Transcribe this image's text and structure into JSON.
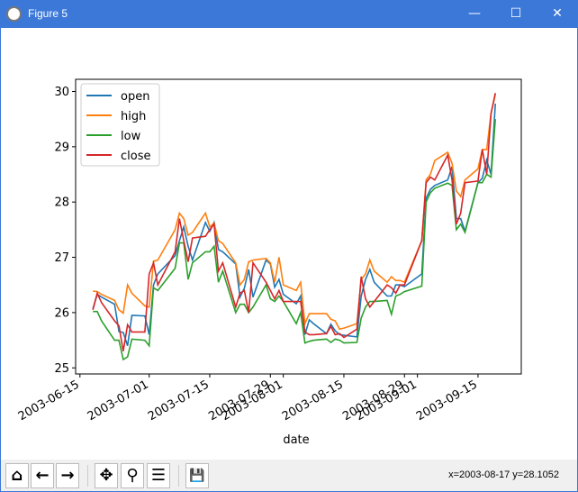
{
  "window": {
    "title": "Figure 5",
    "minimize": "—",
    "maximize": "☐",
    "close": "✕"
  },
  "toolbar": {
    "home": "⌂",
    "back": "←",
    "forward": "→",
    "pan": "✥",
    "zoom": "⚲",
    "configure": "☰",
    "save": "💾",
    "coords": "x=2003-08-17 y=28.1052"
  },
  "chart_data": {
    "type": "line",
    "title": "",
    "xlabel": "date",
    "ylabel": "",
    "xlim": [
      "2003-06-14",
      "2003-09-25"
    ],
    "ylim": [
      24.89,
      30.22
    ],
    "yticks": [
      25,
      26,
      27,
      28,
      29,
      30
    ],
    "xticks": [
      "2003-06-15",
      "2003-07-01",
      "2003-07-15",
      "2003-07-29",
      "2003-08-01",
      "2003-08-15",
      "2003-08-29",
      "2003-09-01",
      "2003-09-15"
    ],
    "legend": {
      "placement": "upper-left",
      "entries": [
        "open",
        "high",
        "low",
        "close"
      ]
    },
    "colors": {
      "open": "#1f77b4",
      "high": "#ff7f0e",
      "low": "#2ca02c",
      "close": "#d62728"
    },
    "x": [
      "2003-06-18",
      "2003-06-19",
      "2003-06-20",
      "2003-06-23",
      "2003-06-24",
      "2003-06-25",
      "2003-06-26",
      "2003-06-27",
      "2003-06-30",
      "2003-07-01",
      "2003-07-02",
      "2003-07-03",
      "2003-07-07",
      "2003-07-08",
      "2003-07-09",
      "2003-07-10",
      "2003-07-11",
      "2003-07-14",
      "2003-07-15",
      "2003-07-16",
      "2003-07-17",
      "2003-07-18",
      "2003-07-21",
      "2003-07-22",
      "2003-07-23",
      "2003-07-24",
      "2003-07-25",
      "2003-07-28",
      "2003-07-29",
      "2003-07-30",
      "2003-07-31",
      "2003-08-01",
      "2003-08-04",
      "2003-08-05",
      "2003-08-06",
      "2003-08-07",
      "2003-08-08",
      "2003-08-11",
      "2003-08-12",
      "2003-08-13",
      "2003-08-14",
      "2003-08-15",
      "2003-08-18",
      "2003-08-19",
      "2003-08-20",
      "2003-08-21",
      "2003-08-22",
      "2003-08-25",
      "2003-08-26",
      "2003-08-27",
      "2003-08-28",
      "2003-08-29",
      "2003-09-02",
      "2003-09-03",
      "2003-09-04",
      "2003-09-05",
      "2003-09-08",
      "2003-09-09",
      "2003-09-10",
      "2003-09-11",
      "2003-09-12",
      "2003-09-15",
      "2003-09-16",
      "2003-09-17",
      "2003-09-18",
      "2003-09-19"
    ],
    "series": [
      {
        "name": "open",
        "values": [
          26.07,
          26.33,
          26.28,
          26.15,
          25.66,
          25.64,
          25.4,
          25.95,
          25.94,
          25.6,
          26.5,
          26.7,
          27.03,
          27.3,
          27.55,
          27.2,
          26.95,
          27.63,
          27.47,
          27.63,
          27.14,
          27.1,
          26.88,
          26.28,
          26.44,
          26.78,
          26.28,
          26.95,
          26.88,
          26.46,
          26.6,
          26.33,
          26.16,
          26.3,
          25.6,
          25.87,
          25.8,
          25.62,
          25.79,
          25.67,
          25.6,
          25.59,
          25.56,
          26.3,
          26.6,
          26.78,
          26.55,
          26.3,
          26.3,
          26.5,
          26.5,
          26.47,
          26.7,
          28.07,
          28.23,
          28.3,
          28.4,
          28.64,
          27.7,
          27.7,
          27.47,
          28.35,
          28.43,
          28.76,
          28.5,
          29.78
        ]
      },
      {
        "name": "high",
        "values": [
          26.39,
          26.38,
          26.33,
          26.22,
          26.05,
          25.99,
          26.5,
          26.35,
          26.12,
          26.1,
          26.93,
          26.95,
          27.5,
          27.8,
          27.7,
          27.4,
          27.45,
          27.8,
          27.55,
          27.62,
          27.3,
          27.25,
          26.9,
          26.5,
          26.6,
          26.92,
          26.95,
          26.98,
          26.9,
          26.55,
          27.0,
          26.5,
          26.4,
          26.55,
          25.8,
          25.98,
          25.98,
          25.98,
          25.88,
          25.85,
          25.7,
          25.72,
          25.8,
          26.6,
          26.7,
          26.95,
          26.75,
          26.55,
          26.65,
          26.58,
          26.58,
          26.55,
          27.3,
          28.4,
          28.5,
          28.75,
          28.9,
          28.7,
          28.2,
          28.1,
          28.4,
          28.6,
          28.95,
          28.95,
          29.6,
          29.95
        ]
      },
      {
        "name": "low",
        "values": [
          26.02,
          26.02,
          25.85,
          25.5,
          25.5,
          25.15,
          25.2,
          25.52,
          25.5,
          25.4,
          26.45,
          26.4,
          26.8,
          27.26,
          27.26,
          26.6,
          26.9,
          27.1,
          27.1,
          27.2,
          26.55,
          26.75,
          26.0,
          26.15,
          26.15,
          26.0,
          26.1,
          26.5,
          26.25,
          26.2,
          26.3,
          26.2,
          25.8,
          26.0,
          25.45,
          25.48,
          25.5,
          25.52,
          25.46,
          25.52,
          25.5,
          25.45,
          25.46,
          25.9,
          26.1,
          26.2,
          26.2,
          26.22,
          25.97,
          26.3,
          26.33,
          26.38,
          26.48,
          28.0,
          28.17,
          28.25,
          28.34,
          28.3,
          27.5,
          27.6,
          27.45,
          28.35,
          28.35,
          28.5,
          28.45,
          29.5
        ]
      },
      {
        "name": "close",
        "values": [
          26.05,
          26.35,
          26.18,
          25.85,
          25.76,
          25.3,
          25.78,
          25.65,
          25.65,
          26.7,
          26.9,
          26.5,
          27.1,
          27.7,
          27.3,
          26.92,
          27.35,
          27.38,
          27.5,
          27.6,
          26.75,
          26.9,
          26.1,
          26.35,
          26.4,
          26.0,
          26.9,
          26.55,
          26.4,
          26.25,
          26.4,
          26.2,
          26.2,
          26.2,
          25.65,
          25.6,
          25.6,
          25.62,
          25.75,
          25.6,
          25.62,
          25.55,
          25.7,
          26.65,
          26.25,
          26.1,
          26.2,
          26.5,
          26.45,
          26.35,
          26.5,
          26.5,
          27.3,
          28.35,
          28.45,
          28.4,
          28.85,
          28.4,
          27.6,
          27.8,
          28.35,
          28.38,
          28.95,
          28.5,
          29.6,
          29.97
        ]
      }
    ]
  }
}
